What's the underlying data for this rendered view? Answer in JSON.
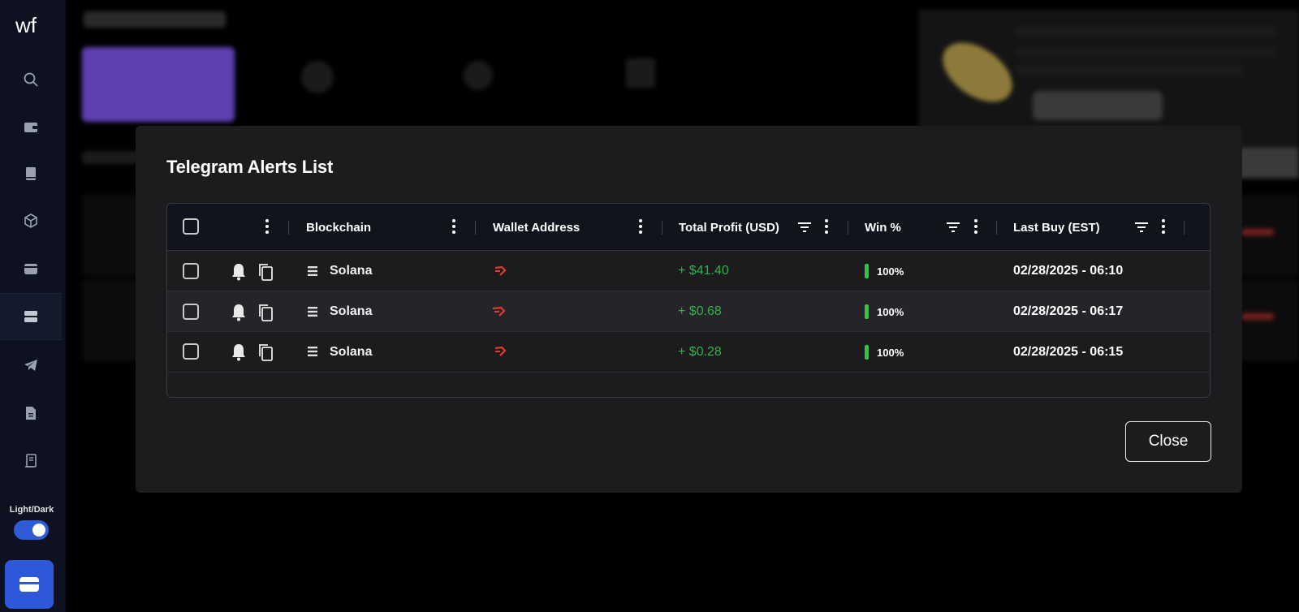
{
  "app": {
    "logo_text": "wf"
  },
  "sidebar": {
    "items": [
      {
        "icon": "search-icon"
      },
      {
        "icon": "wallet-icon"
      },
      {
        "icon": "book-icon"
      },
      {
        "icon": "cube-icon"
      },
      {
        "icon": "card-icon"
      },
      {
        "icon": "server-icon",
        "active": true
      },
      {
        "icon": "telegram-icon"
      },
      {
        "icon": "document-icon"
      },
      {
        "icon": "receipt-icon"
      }
    ],
    "theme_label": "Light/Dark",
    "theme_toggle_on": true
  },
  "modal": {
    "title": "Telegram Alerts List",
    "columns": [
      "Blockchain",
      "Wallet Address",
      "Total Profit (USD)",
      "Win %",
      "Last Buy (EST)"
    ],
    "rows": [
      {
        "blockchain": "Solana",
        "profit": "+ $41.40",
        "win": "100%",
        "last_buy": "02/28/2025 - 06:10"
      },
      {
        "blockchain": "Solana",
        "profit": "+ $0.68",
        "win": "100%",
        "last_buy": "02/28/2025 - 06:17"
      },
      {
        "blockchain": "Solana",
        "profit": "+ $0.28",
        "win": "100%",
        "last_buy": "02/28/2025 - 06:15"
      }
    ],
    "close_label": "Close"
  },
  "colors": {
    "profit": "#2fb34a",
    "win_bar": "#28c840",
    "accent": "#2f57d9",
    "modal_bg": "#1c1b1e"
  }
}
